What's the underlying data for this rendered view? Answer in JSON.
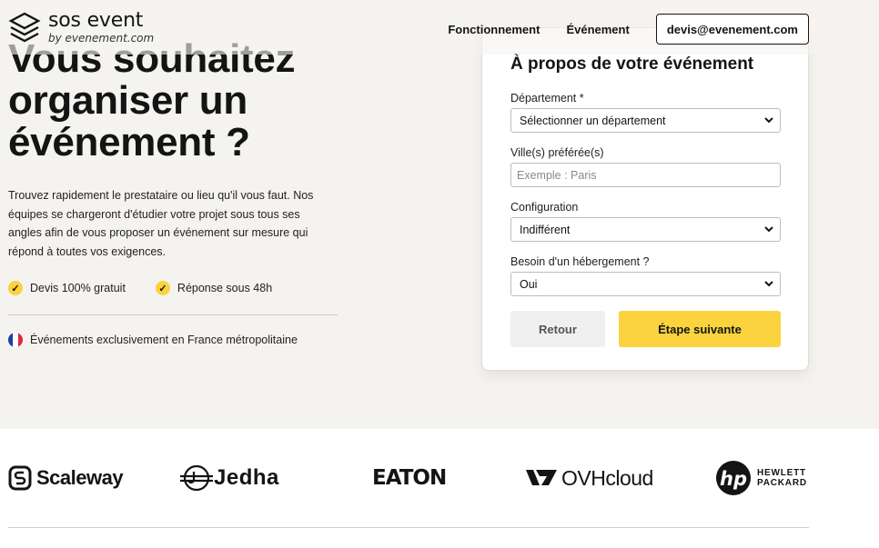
{
  "header": {
    "brand_name": "sos event",
    "brand_sub": "by evenement.com",
    "nav": [
      {
        "label": "Fonctionnement"
      },
      {
        "label": "Événement"
      }
    ],
    "contact_button": "devis@evenement.com"
  },
  "hero": {
    "title": "Vous souhaitez organiser un événement ?",
    "description": "Trouvez rapidement le prestataire ou lieu qu'il vous faut. Nos équipes se chargeront d'étudier votre projet sous tous ses angles afin de vous proposer un événement sur mesure qui répond à toutes vos exigences.",
    "checks": [
      {
        "label": "Devis 100% gratuit"
      },
      {
        "label": "Réponse sous 48h"
      }
    ],
    "france_note": "Événements exclusivement en France métropolitaine"
  },
  "form": {
    "title": "À propos de votre événement",
    "department": {
      "label": "Département *",
      "value": "Sélectionner un département"
    },
    "city": {
      "label": "Ville(s) préférée(s)",
      "placeholder": "Exemple : Paris",
      "value": ""
    },
    "configuration": {
      "label": "Configuration",
      "value": "Indifférent"
    },
    "lodging": {
      "label": "Besoin d'un hébergement ?",
      "value": "Oui"
    },
    "back_button": "Retour",
    "next_button": "Étape suivante"
  },
  "brands": [
    {
      "name": "Scaleway"
    },
    {
      "name": "Jedha"
    },
    {
      "name": "EATON"
    },
    {
      "name": "OVHcloud"
    },
    {
      "name": "HEWLETT",
      "name2": "PACKARD"
    }
  ],
  "colors": {
    "accent": "#fbd33f",
    "hero_bg": "#f5f3f0",
    "text": "#141414",
    "flag_blue": "#1f3fa0",
    "flag_red": "#e1283c"
  }
}
